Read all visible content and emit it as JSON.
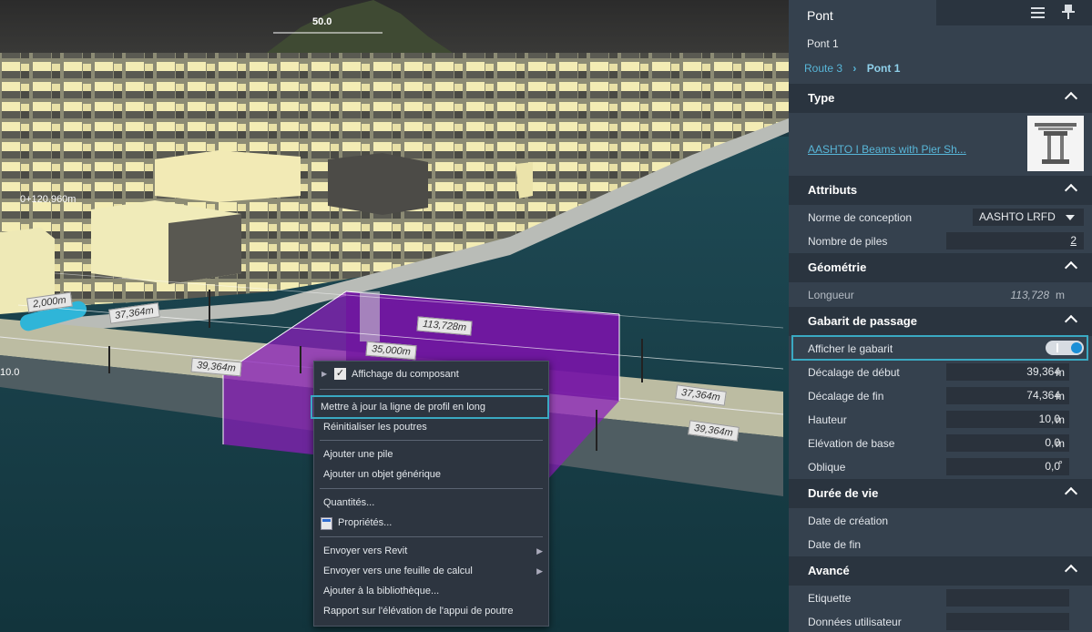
{
  "viewport": {
    "scale_label": "50.0",
    "station_label": "0+120.960m",
    "side_label": "10.0",
    "dimensions": [
      "2,000m",
      "37,364m",
      "113,728m",
      "35,000m",
      "39,364m",
      "37,364m",
      "39,364m"
    ]
  },
  "context_menu": {
    "items": [
      {
        "label": "Affichage du composant",
        "checked": true,
        "submenu_left": true
      },
      {
        "label": "Mettre à jour la ligne de profil en long",
        "highlighted": true
      },
      {
        "label": "Réinitialiser les poutres"
      },
      {
        "label": "Ajouter une pile"
      },
      {
        "label": "Ajouter un objet générique"
      },
      {
        "label": "Quantités..."
      },
      {
        "label": "Propriétés...",
        "icon": "properties-icon"
      },
      {
        "label": "Envoyer vers Revit",
        "submenu": true
      },
      {
        "label": "Envoyer vers une feuille de calcul",
        "submenu": true
      },
      {
        "label": "Ajouter à la bibliothèque..."
      },
      {
        "label": "Rapport sur l'élévation de l'appui de poutre"
      }
    ]
  },
  "panel": {
    "title": "Pont",
    "subtitle": "Pont 1",
    "breadcrumb": {
      "parent": "Route 3",
      "current": "Pont 1"
    },
    "sections": {
      "type": {
        "title": "Type",
        "link": "AASHTO I Beams with Pier Sh..."
      },
      "attributs": {
        "title": "Attributs",
        "norme_label": "Norme de conception",
        "norme_value": "AASHTO LRFD",
        "piles_label": "Nombre de piles",
        "piles_value": "2"
      },
      "geometrie": {
        "title": "Géométrie",
        "longueur_label": "Longueur",
        "longueur_value": "113,728",
        "longueur_unit": "m"
      },
      "gabarit": {
        "title": "Gabarit de passage",
        "afficher_label": "Afficher le gabarit",
        "afficher_on": true,
        "debut_label": "Décalage de début",
        "debut_value": "39,364",
        "debut_unit": "m",
        "fin_label": "Décalage de fin",
        "fin_value": "74,364",
        "fin_unit": "m",
        "hauteur_label": "Hauteur",
        "hauteur_value": "10,0",
        "hauteur_unit": "m",
        "base_label": "Elévation de base",
        "base_value": "0,0",
        "base_unit": "m",
        "oblique_label": "Oblique",
        "oblique_value": "0,0",
        "oblique_unit": "°"
      },
      "duree": {
        "title": "Durée de vie",
        "creation_label": "Date de création",
        "fin_label": "Date de fin"
      },
      "avance": {
        "title": "Avancé",
        "etiquette_label": "Etiquette",
        "donnees_label": "Données utilisateur"
      }
    }
  },
  "colors": {
    "accent": "#3aa9c2",
    "panel_bg": "#35414e",
    "header_bg": "#2a343f",
    "gabarit_purple": "#8a1fb8"
  }
}
